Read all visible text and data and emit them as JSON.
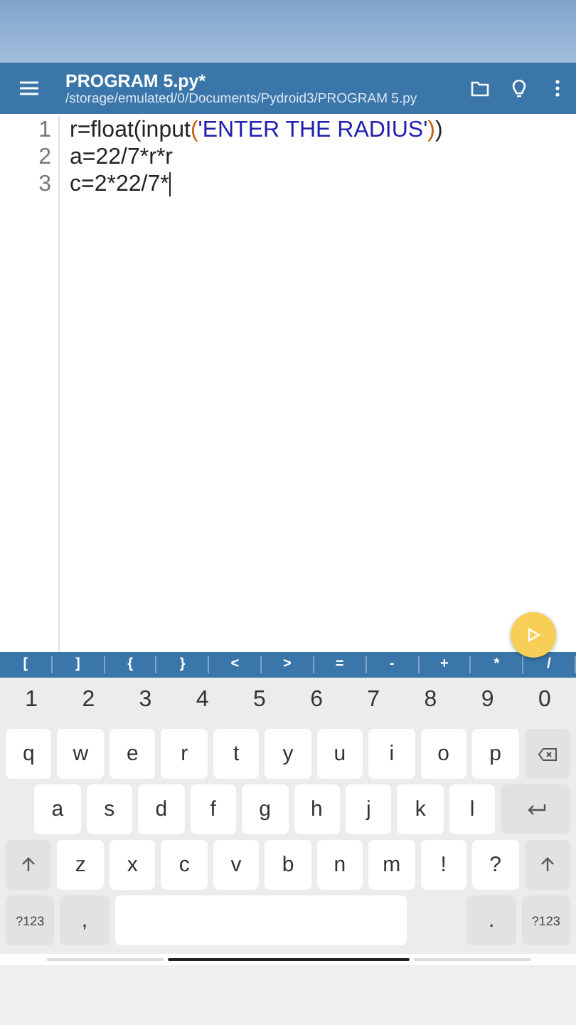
{
  "app_bar": {
    "title": "PROGRAM 5.py*",
    "path": "/storage/emulated/0/Documents/Pydroid3/PROGRAM 5.py"
  },
  "editor": {
    "lines": [
      {
        "number": "1",
        "cursor": false,
        "tokens": [
          {
            "text": "r=float(input",
            "kind": "plain"
          },
          {
            "text": "(",
            "kind": "paren"
          },
          {
            "text": "'ENTER THE RADIUS'",
            "kind": "string"
          },
          {
            "text": ")",
            "kind": "paren"
          },
          {
            "text": ")",
            "kind": "plain"
          }
        ]
      },
      {
        "number": "2",
        "cursor": false,
        "tokens": [
          {
            "text": "a=22/7*r*r",
            "kind": "plain"
          }
        ]
      },
      {
        "number": "3",
        "cursor": true,
        "tokens": [
          {
            "text": "c=2*22/7*",
            "kind": "plain"
          }
        ]
      }
    ]
  },
  "symbol_bar": [
    "[",
    "]",
    "{",
    "}",
    "<",
    ">",
    "=",
    "-",
    "+",
    "*",
    "/"
  ],
  "keyboard": {
    "rows": [
      {
        "keys": [
          {
            "kind": "digit",
            "label": "1"
          },
          {
            "kind": "digit",
            "label": "2"
          },
          {
            "kind": "digit",
            "label": "3"
          },
          {
            "kind": "digit",
            "label": "4"
          },
          {
            "kind": "digit",
            "label": "5"
          },
          {
            "kind": "digit",
            "label": "6"
          },
          {
            "kind": "digit",
            "label": "7"
          },
          {
            "kind": "digit",
            "label": "8"
          },
          {
            "kind": "digit",
            "label": "9"
          },
          {
            "kind": "digit",
            "label": "0"
          }
        ]
      },
      {
        "keys": [
          {
            "kind": "letter",
            "label": "q"
          },
          {
            "kind": "letter",
            "label": "w"
          },
          {
            "kind": "letter",
            "label": "e"
          },
          {
            "kind": "letter",
            "label": "r"
          },
          {
            "kind": "letter",
            "label": "t"
          },
          {
            "kind": "letter",
            "label": "y"
          },
          {
            "kind": "letter",
            "label": "u"
          },
          {
            "kind": "letter",
            "label": "i"
          },
          {
            "kind": "letter",
            "label": "o"
          },
          {
            "kind": "letter",
            "label": "p"
          },
          {
            "kind": "backspace"
          }
        ]
      },
      {
        "keys": [
          {
            "kind": "letter",
            "label": "a"
          },
          {
            "kind": "letter",
            "label": "s"
          },
          {
            "kind": "letter",
            "label": "d"
          },
          {
            "kind": "letter",
            "label": "f"
          },
          {
            "kind": "letter",
            "label": "g"
          },
          {
            "kind": "letter",
            "label": "h"
          },
          {
            "kind": "letter",
            "label": "j"
          },
          {
            "kind": "letter",
            "label": "k"
          },
          {
            "kind": "letter",
            "label": "l"
          },
          {
            "kind": "enter"
          }
        ]
      },
      {
        "keys": [
          {
            "kind": "shift"
          },
          {
            "kind": "letter",
            "label": "z"
          },
          {
            "kind": "letter",
            "label": "x"
          },
          {
            "kind": "letter",
            "label": "c"
          },
          {
            "kind": "letter",
            "label": "v"
          },
          {
            "kind": "letter",
            "label": "b"
          },
          {
            "kind": "letter",
            "label": "n"
          },
          {
            "kind": "letter",
            "label": "m"
          },
          {
            "kind": "letter",
            "label": "!"
          },
          {
            "kind": "letter",
            "label": "?"
          },
          {
            "kind": "shift"
          }
        ]
      },
      {
        "keys": [
          {
            "kind": "mode",
            "label": "?123"
          },
          {
            "kind": "function",
            "label": ","
          },
          {
            "kind": "space"
          },
          {
            "kind": "function",
            "label": "."
          },
          {
            "kind": "mode",
            "label": "?123"
          }
        ]
      }
    ]
  }
}
